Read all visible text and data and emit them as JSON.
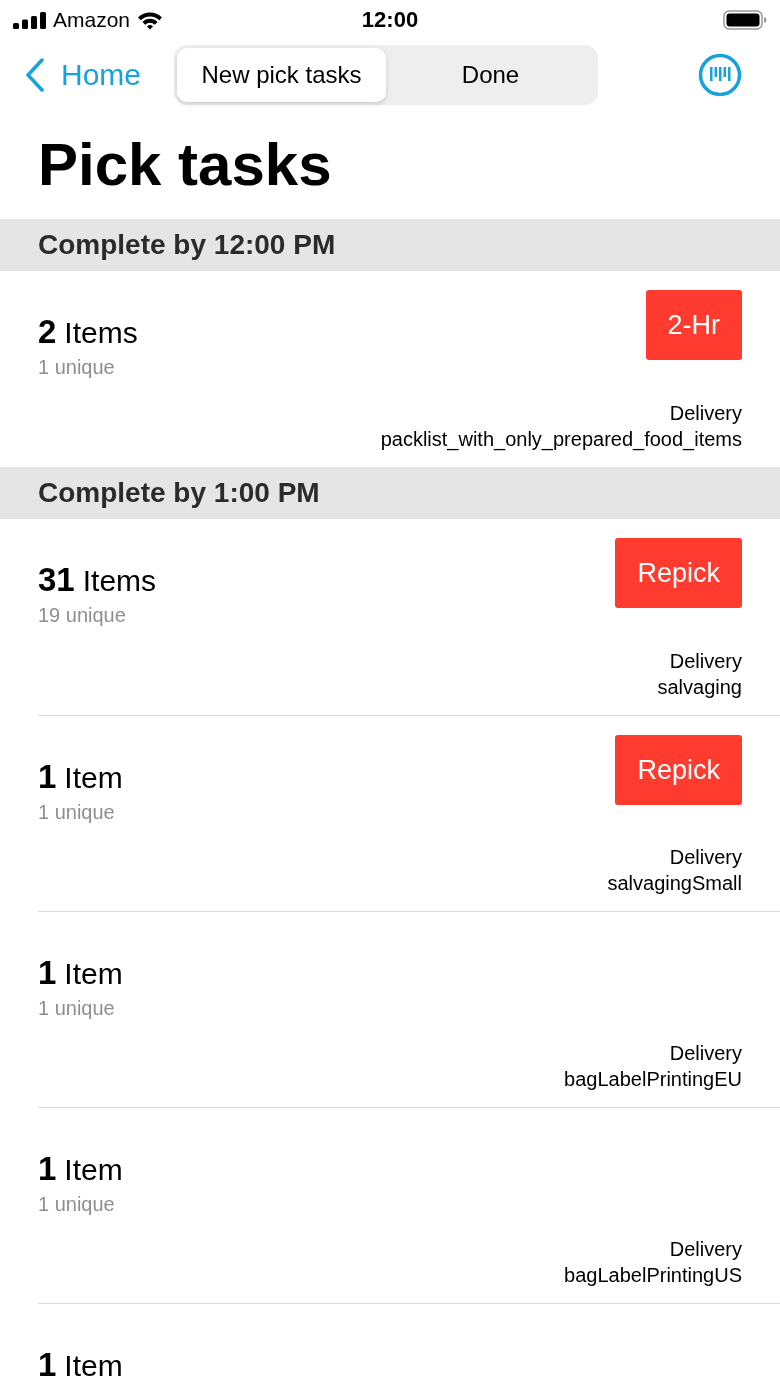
{
  "status_bar": {
    "carrier": "Amazon",
    "time": "12:00"
  },
  "nav_bar": {
    "back_label": "Home",
    "segments": [
      {
        "label": "New pick tasks",
        "selected": true
      },
      {
        "label": "Done",
        "selected": false
      }
    ]
  },
  "title": "Pick tasks",
  "sections": [
    {
      "header": "Complete by 12:00 PM",
      "tasks": [
        {
          "count": "2",
          "unit": "Items",
          "unique": "1 unique",
          "tag": "2-Hr",
          "type": "Delivery",
          "packlist": "packlist_with_only_prepared_food_items"
        }
      ]
    },
    {
      "header": "Complete by 1:00 PM",
      "tasks": [
        {
          "count": "31",
          "unit": "Items",
          "unique": "19 unique",
          "tag": "Repick",
          "type": "Delivery",
          "packlist": "salvaging"
        },
        {
          "count": "1",
          "unit": "Item",
          "unique": "1 unique",
          "tag": "Repick",
          "type": "Delivery",
          "packlist": "salvagingSmall"
        },
        {
          "count": "1",
          "unit": "Item",
          "unique": "1 unique",
          "type": "Delivery",
          "packlist": "bagLabelPrintingEU"
        },
        {
          "count": "1",
          "unit": "Item",
          "unique": "1 unique",
          "type": "Delivery",
          "packlist": "bagLabelPrintingUS"
        },
        {
          "count": "1",
          "unit": "Item"
        }
      ]
    }
  ]
}
